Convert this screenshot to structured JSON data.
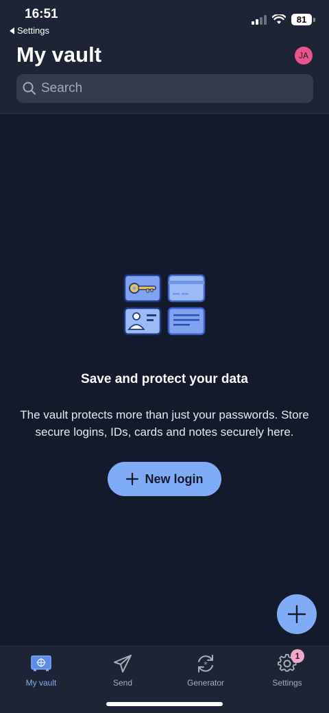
{
  "status_bar": {
    "time": "16:51",
    "back_label": "Settings",
    "battery": "81"
  },
  "header": {
    "title": "My vault",
    "avatar_initials": "JA",
    "search_placeholder": "Search"
  },
  "empty_state": {
    "title": "Save and protect your data",
    "description": "The vault protects more than just your passwords. Store secure logins, IDs, cards and notes securely here.",
    "button_label": "New login"
  },
  "tabs": [
    {
      "label": "My vault",
      "icon": "vault-icon",
      "active": true
    },
    {
      "label": "Send",
      "icon": "send-icon",
      "active": false
    },
    {
      "label": "Generator",
      "icon": "generator-icon",
      "active": false
    },
    {
      "label": "Settings",
      "icon": "gear-icon",
      "active": false,
      "badge": "1"
    }
  ],
  "colors": {
    "background": "#131a2b",
    "header": "#1d2436",
    "accent": "#7fadf5",
    "avatar": "#e9558f",
    "badge": "#f2a7cb"
  }
}
